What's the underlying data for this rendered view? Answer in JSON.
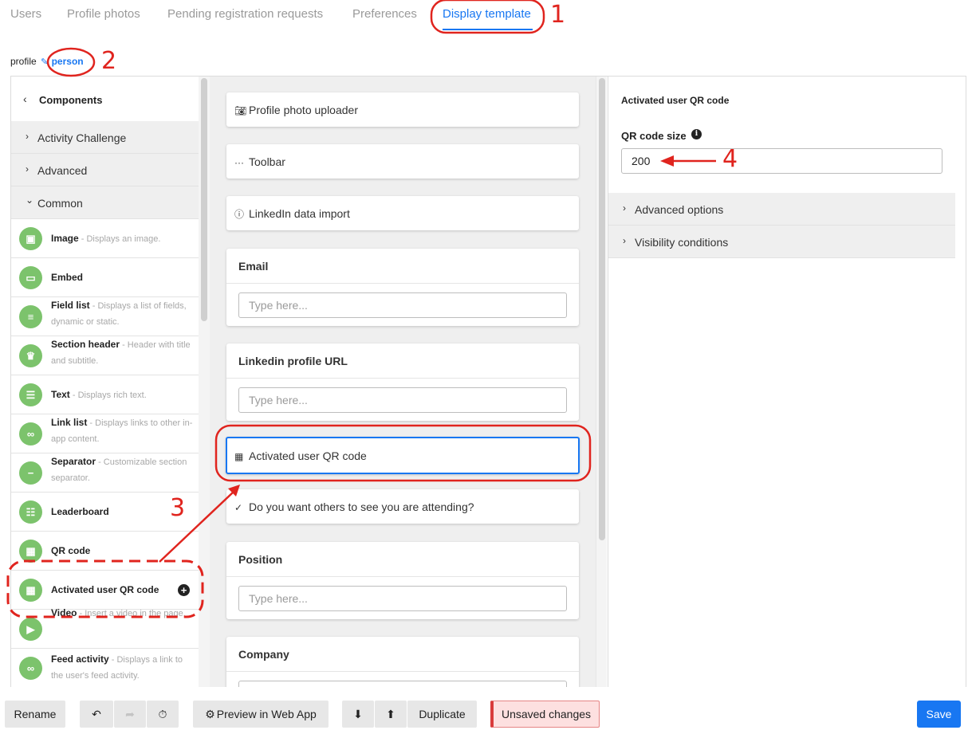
{
  "tabs": [
    {
      "label": "Users"
    },
    {
      "label": "Profile photos"
    },
    {
      "label": "Pending registration requests"
    },
    {
      "label": "Preferences"
    },
    {
      "label": "Display template",
      "active": true
    }
  ],
  "breadcrumb": {
    "prefix": "profile",
    "link": "person"
  },
  "components": {
    "header": "Components",
    "categories": [
      {
        "label": "Activity Challenge"
      },
      {
        "label": "Advanced"
      },
      {
        "label": "Common"
      }
    ],
    "items": [
      {
        "title": "Image",
        "desc": " - Displays an image.",
        "icon": "image-icon"
      },
      {
        "title": "Embed",
        "desc": "",
        "icon": "embed-icon"
      },
      {
        "title": "Field list",
        "desc": " - Displays a list of fields, dynamic or static.",
        "icon": "list-icon"
      },
      {
        "title": "Section header",
        "desc": " - Header with title and subtitle.",
        "icon": "trophy-icon"
      },
      {
        "title": "Text",
        "desc": " - Displays rich text.",
        "icon": "text-icon"
      },
      {
        "title": "Link list",
        "desc": " - Displays links to other in-app content.",
        "icon": "link-icon"
      },
      {
        "title": "Separator",
        "desc": " - Customizable section separator.",
        "icon": "minus-icon"
      },
      {
        "title": "Leaderboard",
        "desc": "",
        "icon": "leaderboard-icon"
      },
      {
        "title": "QR code",
        "desc": "",
        "icon": "qr-icon"
      },
      {
        "title": "Activated user QR code",
        "desc": "",
        "icon": "qr-icon"
      },
      {
        "title": "Video",
        "desc": " - Insert a video in the page.",
        "icon": "video-icon"
      },
      {
        "title": "Feed activity",
        "desc": " - Displays a link to the user's feed activity.",
        "icon": "link-icon"
      }
    ]
  },
  "canvas": {
    "profile_photo_uploader": "Profile photo uploader",
    "toolbar": "Toolbar",
    "linkedin_import": "LinkedIn data import",
    "email": {
      "title": "Email",
      "placeholder": "Type here..."
    },
    "linkedin_url": {
      "title": "Linkedin profile URL",
      "placeholder": "Type here..."
    },
    "activated_qr": "Activated user QR code",
    "attending": "Do you want others to see you are attending?",
    "position": {
      "title": "Position",
      "placeholder": "Type here..."
    },
    "company": {
      "title": "Company"
    }
  },
  "properties": {
    "heading": "Activated user QR code",
    "qr_size_label": "QR code size",
    "qr_size_value": "200",
    "advanced_options": "Advanced options",
    "visibility_conditions": "Visibility conditions"
  },
  "bottom_toolbar": {
    "rename": "Rename",
    "preview": "Preview in Web App",
    "duplicate": "Duplicate",
    "unsaved": "Unsaved changes",
    "save": "Save"
  },
  "annotations": {
    "n1": "1",
    "n2": "2",
    "n3": "3",
    "n4": "4"
  },
  "colors": {
    "accent": "#1877f2",
    "component_icon": "#7cc36c",
    "annotation": "#e0241e"
  }
}
